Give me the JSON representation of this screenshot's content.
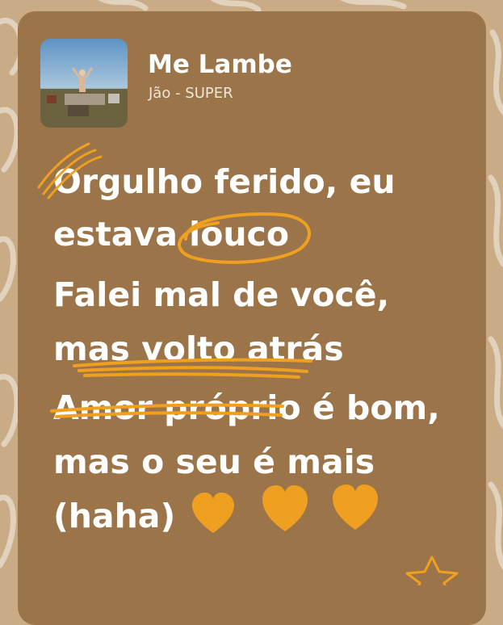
{
  "song": {
    "title": "Me Lambe",
    "artist_album": "Jão - SUPER",
    "cover_icon": "album-cover-image"
  },
  "lyrics": [
    "Orgulho ferido, eu",
    "estava louco",
    "Falei mal de você,",
    "mas volto atrás",
    "Amor próprio é bom,",
    "mas o seu é mais",
    "(haha)"
  ],
  "decorations": {
    "accent_color": "#f0a020",
    "card_color": "#9b7449",
    "background_color": "#c9ab86",
    "heart_count": 3,
    "heart_icon": "heart-icon",
    "star_icon": "star-outline-icon",
    "highlight_word": "louco",
    "underline_phrase": "mas volto atrás",
    "strikethrough_phrase": "Amor própri"
  }
}
